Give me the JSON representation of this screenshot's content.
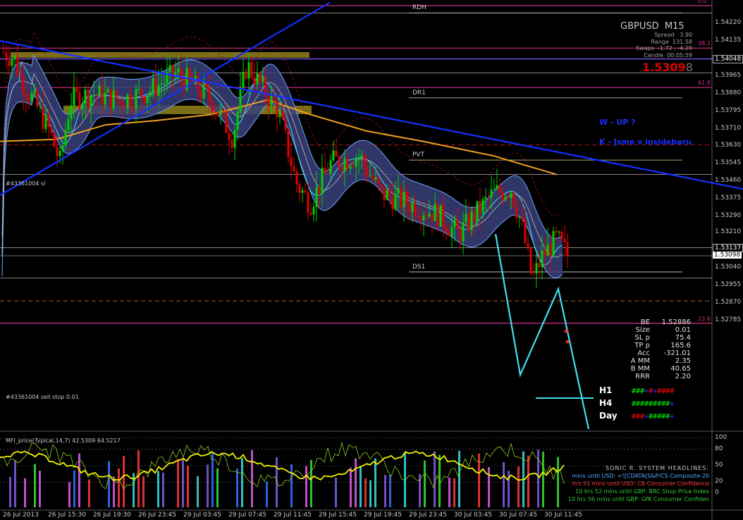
{
  "symbol": {
    "name": "GBPUSD",
    "tf": "M15"
  },
  "info": {
    "spread_label": "Spread",
    "spread": "3.90",
    "range_label": "Range",
    "range": "131.58",
    "swaps_label": "Swaps",
    "swaps": "-1.72 , -4.29",
    "candle_label": "Candle",
    "candle": "00:05:59",
    "bid_main": "1.5309",
    "bid_frac": "8"
  },
  "levels": [
    {
      "label": "RDH",
      "price": 1.5427
    },
    {
      "label": "DR1",
      "price": 1.5386
    },
    {
      "label": "PVT",
      "price": 1.5356
    },
    {
      "label": "DS1",
      "price": 1.5302
    }
  ],
  "fibo": [
    {
      "label": "0.0",
      "price": 1.54305
    },
    {
      "label": "38.2",
      "price": 1.541
    },
    {
      "label": "61.8",
      "price": 1.5391
    },
    {
      "label": "23.6",
      "price": 1.52773
    }
  ],
  "notes": [
    {
      "text": "W - UP ?"
    },
    {
      "text": "K - Jsme v insidebaru"
    }
  ],
  "orders": [
    {
      "text": "#43361004 sl"
    },
    {
      "text": "#43361004 sell stop 0.01"
    }
  ],
  "price_tags": [
    {
      "text": "1.54048",
      "price": 1.54048,
      "style": "box"
    },
    {
      "text": "1.53137",
      "price": 1.53137,
      "style": "box"
    },
    {
      "text": "1.53098",
      "price": 1.53098,
      "style": "white"
    }
  ],
  "stats": [
    {
      "k": "BE",
      "v": "1.52886"
    },
    {
      "k": "Size",
      "v": "0.01"
    },
    {
      "k": "SL p",
      "v": "75.4"
    },
    {
      "k": "TP p",
      "v": "165.6"
    },
    {
      "k": "Acc",
      "v": "-321.01"
    },
    {
      "k": "A MM",
      "v": "2.35"
    },
    {
      "k": "B MM",
      "v": "40.65"
    },
    {
      "k": "RRR",
      "v": "2.20"
    }
  ],
  "trend": [
    {
      "label": "H1",
      "marks": "###+#+####"
    },
    {
      "label": "H4",
      "marks": "#########+"
    },
    {
      "label": "Day",
      "marks": "###+#####+"
    }
  ],
  "price_axis": [
    "1.54220",
    "1.54135",
    "1.53965",
    "1.53880",
    "1.53795",
    "1.53710",
    "1.53630",
    "1.53545",
    "1.53460",
    "1.53375",
    "1.53290",
    "1.53210",
    "1.53040",
    "1.52955",
    "1.52870",
    "1.52785"
  ],
  "time_axis": [
    "26 Jul 2013",
    "26 Jul 15:30",
    "26 Jul 19:30",
    "26 Jul 23:45",
    "29 Jul 03:45",
    "29 Jul 07:45",
    "29 Jul 11:45",
    "29 Jul 15:45",
    "29 Jul 19:45",
    "29 Jul 23:45",
    "30 Jul 03:45",
    "30 Jul 07:45",
    "30 Jul 11:45"
  ],
  "indicator": {
    "title": "MFI_price(Typical,14,7) 42.5309 64.5217",
    "levels": [
      "100",
      "80",
      "50",
      "20",
      "0"
    ]
  },
  "headlines": {
    "title": "SONIC R. SYSTEM HEADLINES:",
    "items": [
      {
        "text": "mins until USD: <![CDATA[S&P/CS Composite-20",
        "color": "#55aaff"
      },
      {
        "text": "hrs 51 mins until USD: CB Consumer Confidence",
        "color": "#ff3333"
      },
      {
        "text": "10 hrs 52 mins until GBP: BRC Shop Price Index",
        "color": "#33cc33"
      },
      {
        "text": "10 hrs 56 mins until GBP: GfK Consumer Confiden",
        "color": "#33cc33"
      }
    ]
  },
  "colors": {
    "bull": "#00d000",
    "bear": "#e00000",
    "ema": "#f0a020",
    "band": "#3a3f7a",
    "trend": "#1530ff",
    "channel": "#40e0f0",
    "fibo": "#d0308a"
  }
}
